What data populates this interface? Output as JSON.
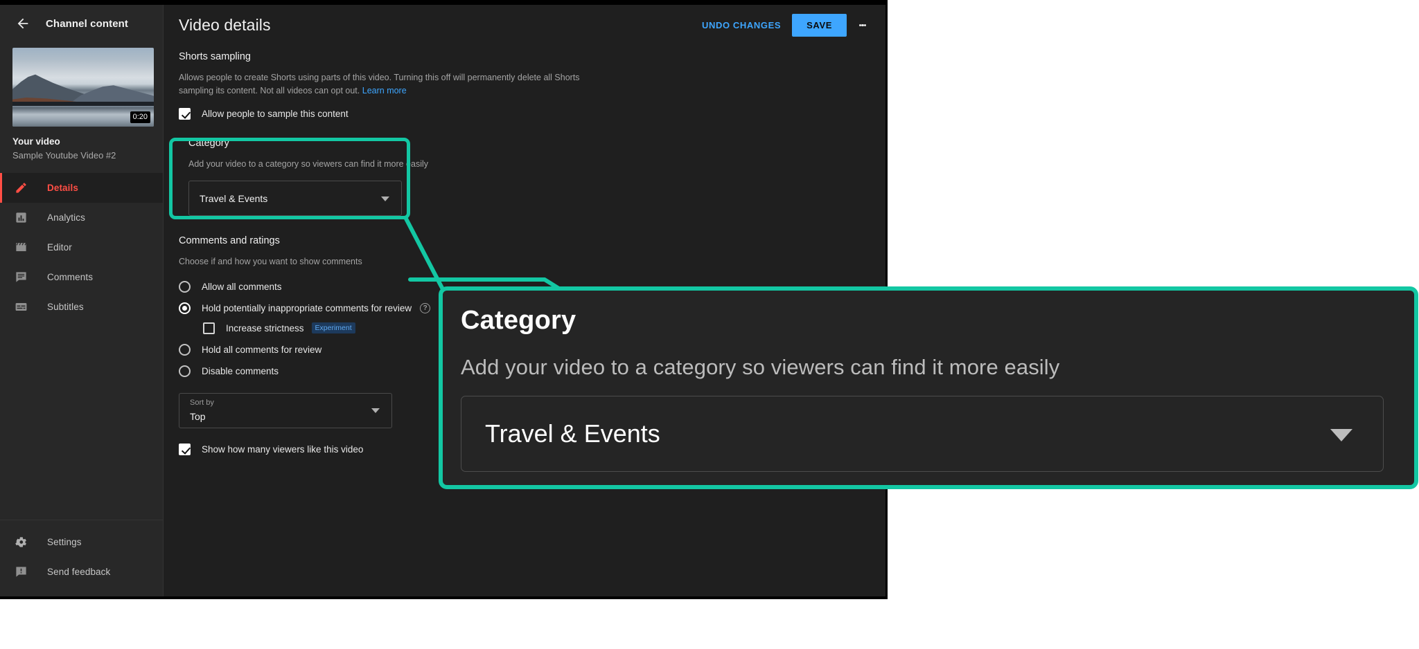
{
  "window": {
    "sidebar": {
      "back_icon": "back-arrow-icon",
      "header_title": "Channel content",
      "thumbnail": {
        "duration": "0:20",
        "alt": "lake-and-mountains-thumbnail"
      },
      "video_label": "Your video",
      "video_title": "Sample Youtube Video #2",
      "items": [
        {
          "label": "Details",
          "icon": "pencil-icon",
          "active": true
        },
        {
          "label": "Analytics",
          "icon": "bar-chart-icon",
          "active": false
        },
        {
          "label": "Editor",
          "icon": "clapperboard-icon",
          "active": false
        },
        {
          "label": "Comments",
          "icon": "comment-icon",
          "active": false
        },
        {
          "label": "Subtitles",
          "icon": "subtitles-icon",
          "active": false
        }
      ],
      "bottom_items": [
        {
          "label": "Settings",
          "icon": "gear-icon"
        },
        {
          "label": "Send feedback",
          "icon": "feedback-icon"
        }
      ]
    },
    "header": {
      "title": "Video details",
      "undo_label": "UNDO CHANGES",
      "save_label": "SAVE",
      "menu_icon": "kebab-menu-icon"
    },
    "shorts_sampling": {
      "title": "Shorts sampling",
      "description": "Allows people to create Shorts using parts of this video. Turning this off will permanently delete all Shorts sampling its content. Not all videos can opt out.",
      "learn_more": "Learn more",
      "checkbox_label": "Allow people to sample this content",
      "checkbox_checked": true
    },
    "category": {
      "title": "Category",
      "description": "Add your video to a category so viewers can find it more easily",
      "selected": "Travel & Events",
      "caret_icon": "chevron-down-icon"
    },
    "comments": {
      "title": "Comments and ratings",
      "description": "Choose if and how you want to show comments",
      "options": [
        {
          "label": "Allow all comments",
          "selected": false
        },
        {
          "label": "Hold potentially inappropriate comments for review",
          "selected": true
        },
        {
          "label": "Hold all comments for review",
          "selected": false
        },
        {
          "label": "Disable comments",
          "selected": false
        }
      ],
      "sub_option": {
        "label": "Increase strictness",
        "badge": "Experiment",
        "checked": false
      },
      "help_icon": "help-circle-icon",
      "sort": {
        "float_label": "Sort by",
        "value": "Top"
      },
      "show_likes": {
        "label": "Show how many viewers like this video",
        "checked": true
      }
    }
  },
  "callout": {
    "title": "Category",
    "description": "Add your video to a category so viewers can find it more easily",
    "selected": "Travel & Events",
    "caret_icon": "chevron-down-icon"
  },
  "colors": {
    "highlight": "#13c7a3",
    "accent_blue": "#3ea6ff",
    "active_red": "#ff4e45",
    "app_bg": "#1f1f1f",
    "sidebar_bg": "#282828"
  }
}
